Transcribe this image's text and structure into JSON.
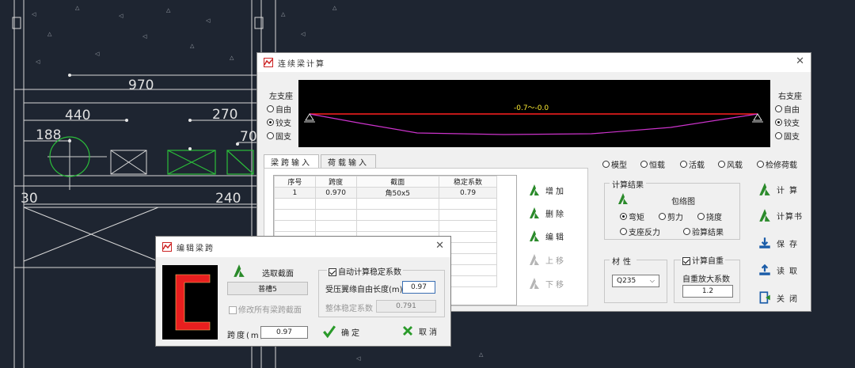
{
  "colors": {
    "accent": "#2a8a2a",
    "beam": "#ff2020",
    "deflection": "#cc33cc",
    "cad_bg": "#1e2531"
  },
  "cad": {
    "dims": [
      "970",
      "440",
      "270",
      "188",
      "70",
      "30",
      "240"
    ]
  },
  "main": {
    "title": "连续梁计算",
    "left_support": {
      "label": "左支座",
      "options": [
        "自由",
        "铰支",
        "固支"
      ],
      "selected": 1
    },
    "right_support": {
      "label": "右支座",
      "options": [
        "自由",
        "铰支",
        "固支"
      ],
      "selected": 1
    },
    "preview_label": "-0.7～-0.0",
    "tabs": [
      "梁跨输入",
      "荷载输入"
    ],
    "table": {
      "headers": [
        "序号",
        "跨度",
        "截面",
        "稳定系数"
      ],
      "rows": [
        [
          "1",
          "0.970",
          "角50x5",
          "0.79"
        ]
      ]
    },
    "span_buttons": {
      "add": "增加",
      "delete": "删除",
      "edit": "编辑",
      "up": "上移",
      "down": "下移"
    },
    "view_modes": [
      "模型",
      "恒载",
      "活载",
      "风载",
      "检修荷载"
    ],
    "calc_results": {
      "label": "计算结果",
      "envelope": "包络图",
      "options": [
        "弯矩",
        "剪力",
        "挠度",
        "支座反力",
        "验算结果"
      ],
      "selected": 0
    },
    "material": {
      "label": "材性",
      "value": "Q235"
    },
    "self_weight": {
      "label": "计算自重",
      "checked": true,
      "factor_label": "自重放大系数",
      "factor": "1.2"
    },
    "actions": {
      "calc": "计算",
      "calc_book": "计算书",
      "save": "保存",
      "load": "读取",
      "close": "关闭"
    }
  },
  "edit": {
    "title": "编辑梁跨",
    "select_section": "选取截面",
    "section_name": "普槽5",
    "modify_all": "修改所有梁跨截面",
    "span_label": "跨度(m)",
    "span_value": "0.97",
    "auto_stab": "自动计算稳定系数",
    "free_len_label": "受压翼缘自由长度(m)",
    "free_len_value": "0.97",
    "stab_label": "整体稳定系数",
    "stab_value": "0.791",
    "ok": "确定",
    "cancel": "取消"
  }
}
